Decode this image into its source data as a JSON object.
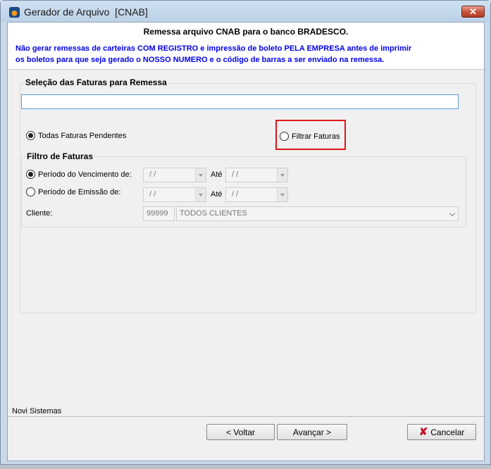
{
  "window": {
    "title": "Gerador de Arquivo  [CNAB]",
    "close_label": "✕"
  },
  "header": {
    "title": "Remessa arquivo CNAB para o banco BRADESCO.",
    "warning_line1": "Não gerar remessas de carteiras COM REGISTRO e impressão de boleto PELA EMPRESA antes de imprimir",
    "warning_line2": "os boletos para que seja gerado o NOSSO NUMERO e o código de barras a ser enviado na remessa."
  },
  "selection": {
    "group_label": "Seleção das Faturas para Remessa",
    "search_value": "",
    "radio_all": "Todas Faturas Pendentes",
    "radio_filter": "Filtrar Faturas",
    "selected": "all"
  },
  "filter": {
    "group_label": "Filtro de Faturas",
    "vencimento_label": "Período do Vencimento  de:",
    "emissao_label": "Período de Emissão  de:",
    "ate_label": "Até",
    "date_placeholder": "/ /",
    "selected": "vencimento",
    "cliente_label": "Cliente:",
    "cliente_code": "99999",
    "cliente_name": "TODOS CLIENTES"
  },
  "footer": {
    "company": "Novi Sistemas",
    "back_label": "< Voltar",
    "next_label": "Avançar >",
    "cancel_label": "Cancelar"
  },
  "colors": {
    "warning_text": "#0000ee",
    "highlight_border": "#e01515",
    "cancel_icon": "#c8102e"
  }
}
